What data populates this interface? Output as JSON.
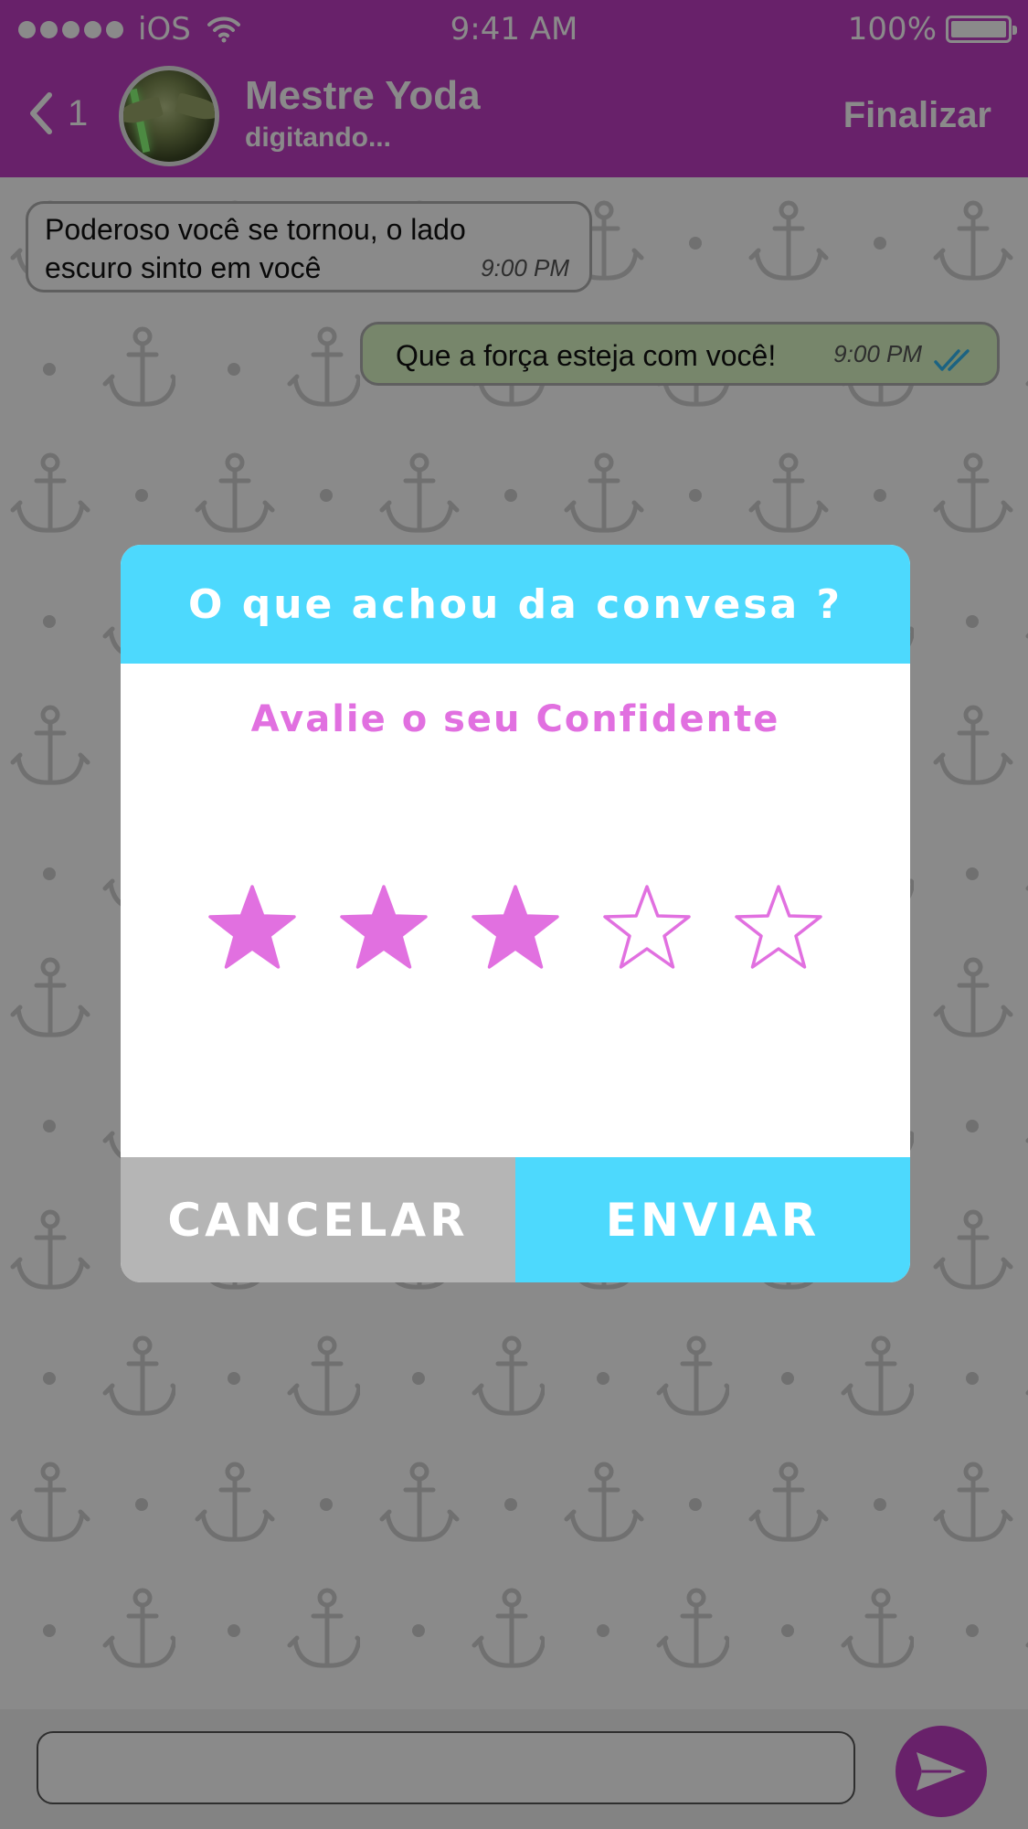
{
  "status_bar": {
    "carrier": "iOS",
    "time": "9:41 AM",
    "battery": "100%"
  },
  "header": {
    "back_count": "1",
    "contact_name": "Mestre Yoda",
    "contact_status": "digitando...",
    "finish_label": "Finalizar"
  },
  "messages": [
    {
      "direction": "incoming",
      "text_line1": "Poderoso você se tornou, o lado",
      "text_line2": "escuro sinto em você",
      "time": "9:00 PM"
    },
    {
      "direction": "outgoing",
      "text": "Que a força esteja com você!",
      "time": "9:00 PM",
      "read": true
    }
  ],
  "composer": {
    "placeholder": "",
    "send_icon": "send-icon"
  },
  "dialog": {
    "title": "O que achou da convesa ?",
    "subtitle": "Avalie o seu Confidente",
    "rating": {
      "value": 3,
      "max": 5
    },
    "cancel_label": "CANCELAR",
    "submit_label": "ENVIAR"
  },
  "colors": {
    "brand_purple": "#c13dc4",
    "dialog_cyan": "#4dd9fd",
    "star_pink": "#e170e0",
    "cancel_gray": "#b5b5b5",
    "outgoing_bubble": "#dcf8c6"
  }
}
